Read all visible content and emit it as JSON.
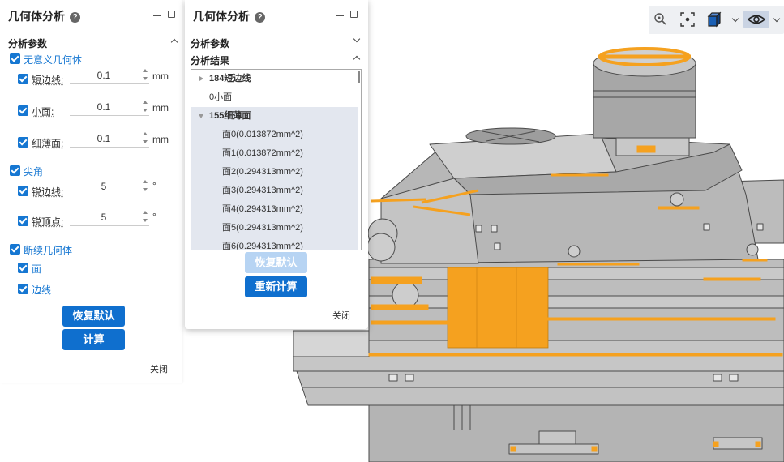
{
  "panel1": {
    "title": "几何体分析",
    "section_params": "分析参数",
    "group_meaningless": "无意义几何体",
    "short_edge": {
      "label": "短边线:",
      "value": "0.1",
      "unit": "mm"
    },
    "small_face": {
      "label": "小面:",
      "value": "0.1",
      "unit": "mm"
    },
    "thin_face": {
      "label": "细薄面:",
      "value": "0.1",
      "unit": "mm"
    },
    "group_sharp": "尖角",
    "sharp_edge": {
      "label": "锐边线:",
      "value": "5",
      "unit": "°"
    },
    "sharp_vertex": {
      "label": "锐顶点:",
      "value": "5",
      "unit": "°"
    },
    "group_broken": "断续几何体",
    "face": "面",
    "edge": "边线",
    "reset_label": "恢复默认",
    "calc_label": "计算",
    "close_label": "关闭"
  },
  "panel2": {
    "title": "几何体分析",
    "section_params": "分析参数",
    "section_results": "分析结果",
    "tree": [
      {
        "label": "184短边线",
        "type": "group",
        "expanded": false
      },
      {
        "label": "0小面",
        "type": "group"
      },
      {
        "label": "155细薄面",
        "type": "group",
        "expanded": true
      },
      {
        "label": "面0(0.013872mm^2)",
        "type": "leaf"
      },
      {
        "label": "面1(0.013872mm^2)",
        "type": "leaf"
      },
      {
        "label": "面2(0.294313mm^2)",
        "type": "leaf"
      },
      {
        "label": "面3(0.294313mm^2)",
        "type": "leaf"
      },
      {
        "label": "面4(0.294313mm^2)",
        "type": "leaf"
      },
      {
        "label": "面5(0.294313mm^2)",
        "type": "leaf"
      },
      {
        "label": "面6(0.294313mm^2)",
        "type": "leaf"
      }
    ],
    "reset_label": "恢复默认",
    "recalc_label": "重新计算",
    "close_label": "关闭"
  },
  "toolbar": {
    "icons": [
      "zoom-icon",
      "fit-view-icon",
      "cube-view-icon",
      "visibility-eye-icon"
    ]
  },
  "colors": {
    "accent": "#1677d2",
    "highlight": "#f5a11f",
    "model": "#b8b8b8"
  }
}
